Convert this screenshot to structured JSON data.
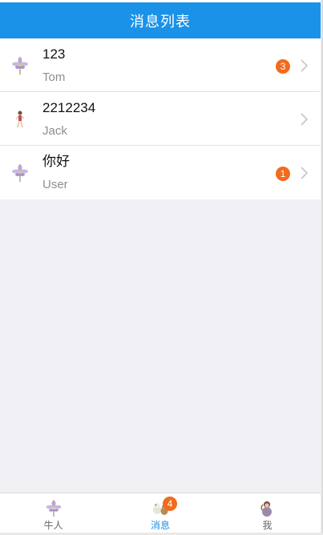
{
  "header": {
    "title": "消息列表"
  },
  "messages": [
    {
      "title": "123",
      "sender": "Tom",
      "unread": "3",
      "avatar": "flower-icon"
    },
    {
      "title": "2212234",
      "sender": "Jack",
      "unread": "",
      "avatar": "figure-icon"
    },
    {
      "title": "你好",
      "sender": "User",
      "unread": "1",
      "avatar": "flower-icon"
    }
  ],
  "tabs": [
    {
      "label": "牛人",
      "icon": "flower-icon"
    },
    {
      "label": "消息",
      "icon": "animals-icon",
      "badge": "4",
      "active": true
    },
    {
      "label": "我",
      "icon": "person-icon"
    }
  ],
  "colors": {
    "header": "#1a92e8",
    "badge": "#f26b1d",
    "active_tab": "#1a92e8",
    "background": "#f0f0f5"
  }
}
